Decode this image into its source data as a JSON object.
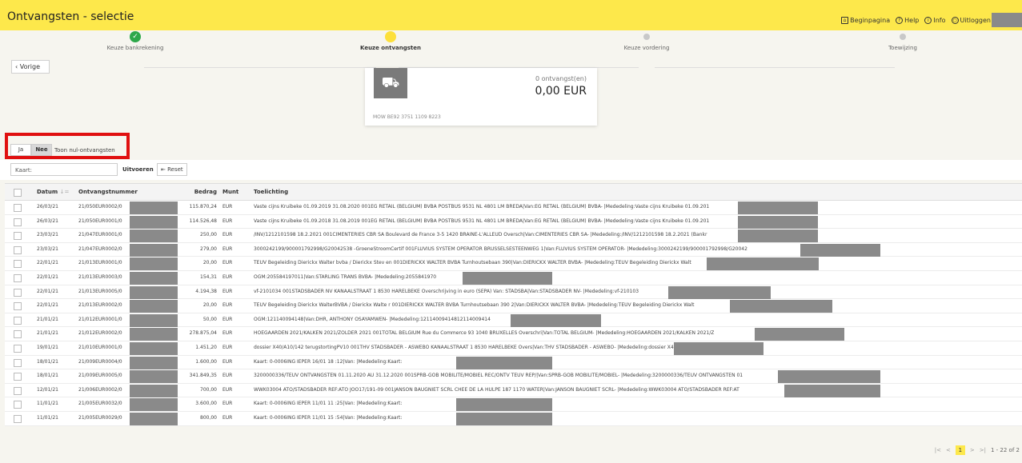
{
  "header": {
    "title": "Ontvangsten - selectie",
    "links": [
      "Beginpagina",
      "Help",
      "Info",
      "Uitloggen"
    ]
  },
  "steps": [
    {
      "label": "Keuze bankrekening",
      "state": "done"
    },
    {
      "label": "Keuze ontvangsten",
      "state": "current"
    },
    {
      "label": "Keuze vordering",
      "state": "todo"
    },
    {
      "label": "Toewijzing",
      "state": "todo"
    }
  ],
  "nav": {
    "previous_label": "Vorige"
  },
  "summary": {
    "count_label": "0 ontvangst(en)",
    "amount": "0,00 EUR",
    "account": "MOW BE92 3751 1109 8223"
  },
  "toggle": {
    "yes": "Ja",
    "no": "Nee",
    "label": "Toon nul-ontvangsten"
  },
  "filter": {
    "search_value": "Kaart:",
    "execute_label": "Uitvoeren",
    "reset_label": "Reset"
  },
  "table": {
    "headers": {
      "date": "Datum",
      "number": "Ontvangstnummer",
      "amount": "Bedrag",
      "currency": "Munt",
      "description": "Toelichting"
    },
    "rows": [
      {
        "date": "26/03/21",
        "number": "21/050EUR0002/0",
        "amount": "115.870,24",
        "currency": "EUR",
        "description": "Vaste cijns Kruibeke 01.09.2019 31.08.2020 001EG RETAIL (BELGIUM) BVBA POSTBUS 9531 NL 4801 LM BREDA|Van:EG RETAIL (BELGIUM) BVBA- |Mededeling:Vaste cijns Kruibeke 01.09.201"
      },
      {
        "date": "26/03/21",
        "number": "21/050EUR0001/0",
        "amount": "114.526,48",
        "currency": "EUR",
        "description": "Vaste cijns Kruibeke 01.09.2018 31.08.2019 001EG RETAIL (BELGIUM) BVBA POSTBUS 9531 NL 4801 LM BREDA|Van:EG RETAIL (BELGIUM) BVBA- |Mededeling:Vaste cijns Kruibeke 01.09.201"
      },
      {
        "date": "23/03/21",
        "number": "21/047EUR0001/0",
        "amount": "250,00",
        "currency": "EUR",
        "description": "/INV/1212101598 18.2.2021 001CIMENTERIES CBR SA Boulevard de France 3-5 1420 BRAINE-L'ALLEUD Oversch|Van:CIMENTERIES CBR SA- |Mededeling:/INV/1212101598 18.2.2021 (Bankr"
      },
      {
        "date": "23/03/21",
        "number": "21/047EUR0002/0",
        "amount": "279,00",
        "currency": "EUR",
        "description": "3000242199/900001792998/G20042538 -GroeneStroomCertif 001FLUVIUS SYSTEM OPERATOR BRUSSELSESTEENWEG 1|Van:FLUVIUS SYSTEM OPERATOR- |Mededeling:3000242199/900001792998/G20042"
      },
      {
        "date": "22/01/21",
        "number": "21/013EUR0001/0",
        "amount": "20,00",
        "currency": "EUR",
        "description": "TEUV Begeleiding Dierickx Walter bvba / Dierickx Stev en 001DIERICKX WALTER BVBA Turnhoutsebaan 390|Van:DIERICKX WALTER BVBA- |Mededeling:TEUV Begeleiding Dierickx Walt"
      },
      {
        "date": "22/01/21",
        "number": "21/013EUR0003/0",
        "amount": "154,31",
        "currency": "EUR",
        "description": "OGM:205584197011|Van:STARLING TRANS BVBA- |Mededeling:2055841970"
      },
      {
        "date": "22/01/21",
        "number": "21/013EUR0005/0",
        "amount": "4.194,38",
        "currency": "EUR",
        "description": "vf-2101034 001STADSBADER NV KANAALSTRAAT 1 8530 HARELBEKE Overschrijving in euro (SEPA) Van: STADSBA|Van:STADSBADER NV- |Mededeling:vf-210103"
      },
      {
        "date": "22/01/21",
        "number": "21/013EUR0002/0",
        "amount": "20,00",
        "currency": "EUR",
        "description": "TEUV Begeleiding Dierickx WalterBVBA / Dierickx Walte r 001DIERICKX WALTER BVBA Turnhoutsebaan 390 2|Van:DIERICKX WALTER BVBA- |Mededeling:TEUV Begeleiding Dierickx Walt"
      },
      {
        "date": "21/01/21",
        "number": "21/012EUR0001/0",
        "amount": "50,00",
        "currency": "EUR",
        "description": "OGM:121140094148|Van:DHR, ANTHONY OSAYAMWEN- |Mededeling:12114009414812114009414"
      },
      {
        "date": "21/01/21",
        "number": "21/012EUR0002/0",
        "amount": "278.875,04",
        "currency": "EUR",
        "description": "HOEGAARDEN 2021/KALKEN 2021/ZOLDER 2021 001TOTAL BELGIUM Rue du Commerce 93 1040 BRUXELLES Overschri|Van:TOTAL BELGIUM- |Mededeling:HOEGAARDEN 2021/KALKEN 2021/Z"
      },
      {
        "date": "19/01/21",
        "number": "21/010EUR0001/0",
        "amount": "1.451,20",
        "currency": "EUR",
        "description": "dossier X40/A10/142 terugstortingPV10 001THV STADSBADER - ASWEBO KANAALSTRAAT 1 8530 HARELBEKE Overs|Van:THV STADSBADER - ASWEBO- |Mededeling:dossier X40/A10/142 terugs"
      },
      {
        "date": "18/01/21",
        "number": "21/009EUR0004/0",
        "amount": "1.600,00",
        "currency": "EUR",
        "description": "Kaart:            0-0006ING IEPER 16/01 18 :12|Van: |Mededeling:Kaart:"
      },
      {
        "date": "18/01/21",
        "number": "21/009EUR0005/0",
        "amount": "341.849,35",
        "currency": "EUR",
        "description": "3200000336/TEUV ONTVANGSTEN 01.11.2020 AU 31.12.2020 001SPRB-GOB MOBILITE/MOBIEL REC/ONTV TEUV REP/|Van:SPRB-GOB MOBILITE/MOBIEL- |Mededeling:3200000336/TEUV ONTVANGSTEN 01"
      },
      {
        "date": "12/01/21",
        "number": "21/006EUR0002/0",
        "amount": "700,00",
        "currency": "EUR",
        "description": "WWK03004 ATO/STADSBADER REF:ATO JOO17/191-09 001JANSON BAUGNIET SCRL CHEE DE LA HULPE 187 1170 WATER|Van:JANSON BAUGNIET SCRL- |Mededeling:WWK03004 ATO/STADSBADER REF:AT"
      },
      {
        "date": "11/01/21",
        "number": "21/005EUR0032/0",
        "amount": "3.600,00",
        "currency": "EUR",
        "description": "Kaart:            0-0006ING IEPER 11/01 11 :25|Van: |Mededeling:Kaart:"
      },
      {
        "date": "11/01/21",
        "number": "21/005EUR0029/0",
        "amount": "800,00",
        "currency": "EUR",
        "description": "Kaart:            0-0006ING IEPER 11/01 15 :54|Van: |Mededeling:Kaart:"
      }
    ]
  },
  "pagination": {
    "current_page": "1",
    "range": "1 - 22 of 2"
  }
}
